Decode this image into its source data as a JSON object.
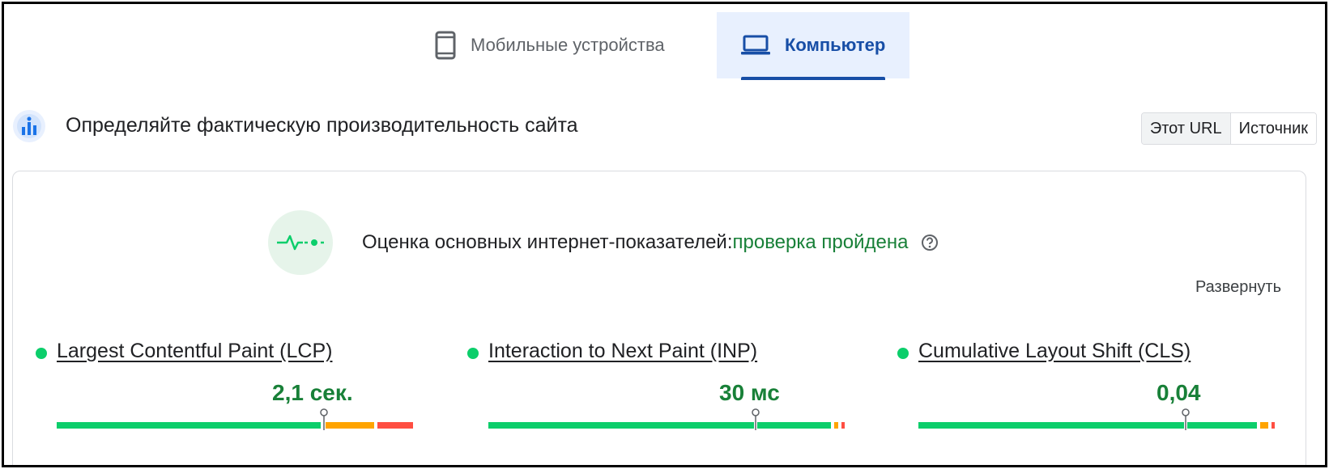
{
  "tabs": {
    "mobile_label": "Мобильные устройства",
    "desktop_label": "Компьютер"
  },
  "section": {
    "title": "Определяйте фактическую производительность сайта",
    "toggle_url": "Этот URL",
    "toggle_origin": "Источник"
  },
  "assessment": {
    "label": "Оценка основных интернет-показателей:",
    "result": "проверка пройдена",
    "expand": "Развернуть"
  },
  "metrics": {
    "lcp": {
      "name": "Largest Contentful Paint (LCP)",
      "value": "2,1 сек.",
      "good": 0.75,
      "ni": 0.15,
      "poor": 0.1,
      "marker": 0.75
    },
    "inp": {
      "name": "Interaction to Next Paint (INP)",
      "value": "30 мс",
      "good": 0.97,
      "ni": 0.02,
      "poor": 0.01,
      "marker": 0.75
    },
    "cls": {
      "name": "Cumulative Layout Shift (CLS)",
      "value": "0,04",
      "good": 0.96,
      "ni": 0.03,
      "poor": 0.01,
      "marker": 0.75
    }
  },
  "colors": {
    "good": "#0cce6b",
    "needs_improvement": "#ffa400",
    "poor": "#ff4e42",
    "accent": "#174ea6",
    "pass_text": "#188038"
  },
  "icons": [
    "smartphone-icon",
    "laptop-icon",
    "crux-icon",
    "pulse-icon",
    "help-icon",
    "marker-icon"
  ]
}
